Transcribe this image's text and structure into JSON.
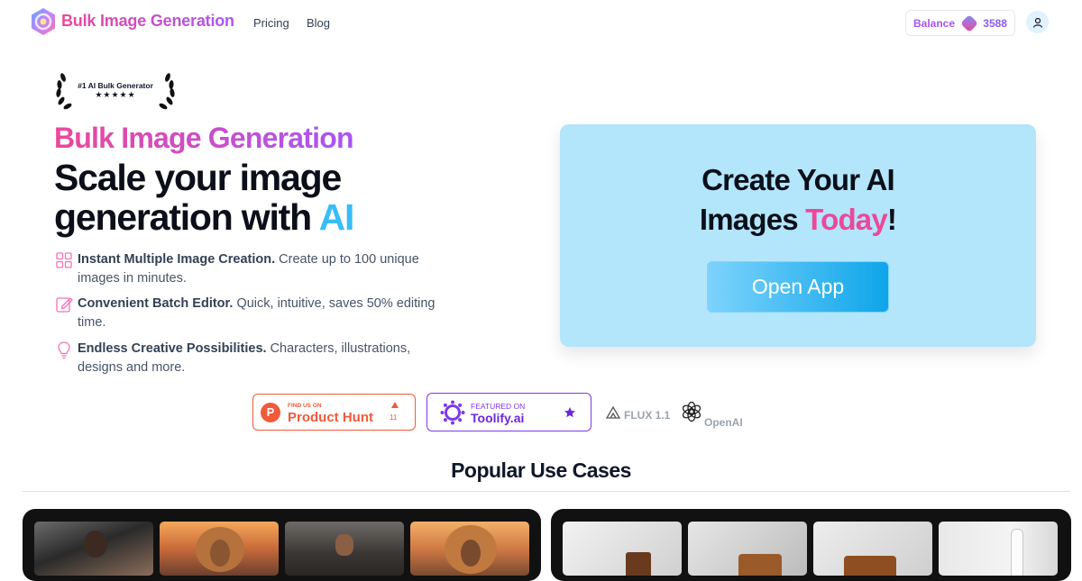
{
  "header": {
    "brand": "Bulk Image Generation",
    "nav": [
      "Pricing",
      "Blog"
    ],
    "balance_label": "Balance",
    "balance_value": "3588"
  },
  "award": {
    "line1": "#1 AI Bulk Generator",
    "stars": "★★★★★"
  },
  "hero": {
    "subtitle": "Bulk Image Generation",
    "title_line1": "Scale your image",
    "title_line2_prefix": "generation with ",
    "title_line2_ai": "AI",
    "features": [
      {
        "bold": "Instant Multiple Image Creation.",
        "text": " Create up to 100 unique images in minutes.",
        "icon": "grid-icon"
      },
      {
        "bold": "Convenient Batch Editor.",
        "text": " Quick, intuitive, saves 50% editing time.",
        "icon": "edit-icon"
      },
      {
        "bold": "Endless Creative Possibilities.",
        "text": " Characters, illustrations, designs and more.",
        "icon": "lightbulb-icon"
      }
    ]
  },
  "cta": {
    "line1": "Create Your AI",
    "line2_prefix": "Images ",
    "line2_highlight": "Today",
    "line2_suffix": "!",
    "button": "Open App"
  },
  "badges": {
    "producthunt_small": "FIND US ON",
    "producthunt_name": "Product Hunt",
    "producthunt_count": "11",
    "toolify_small": "FEATURED ON",
    "toolify_name": "Toolify.ai",
    "flux": "FLUX 1.1",
    "openai": "OpenAI"
  },
  "use_cases": {
    "title": "Popular Use Cases"
  },
  "colors": {
    "brand_pink": "#ec4899",
    "brand_purple": "#a855f7",
    "ai_blue": "#38bdf8",
    "card_bg": "#b3e5fb"
  }
}
